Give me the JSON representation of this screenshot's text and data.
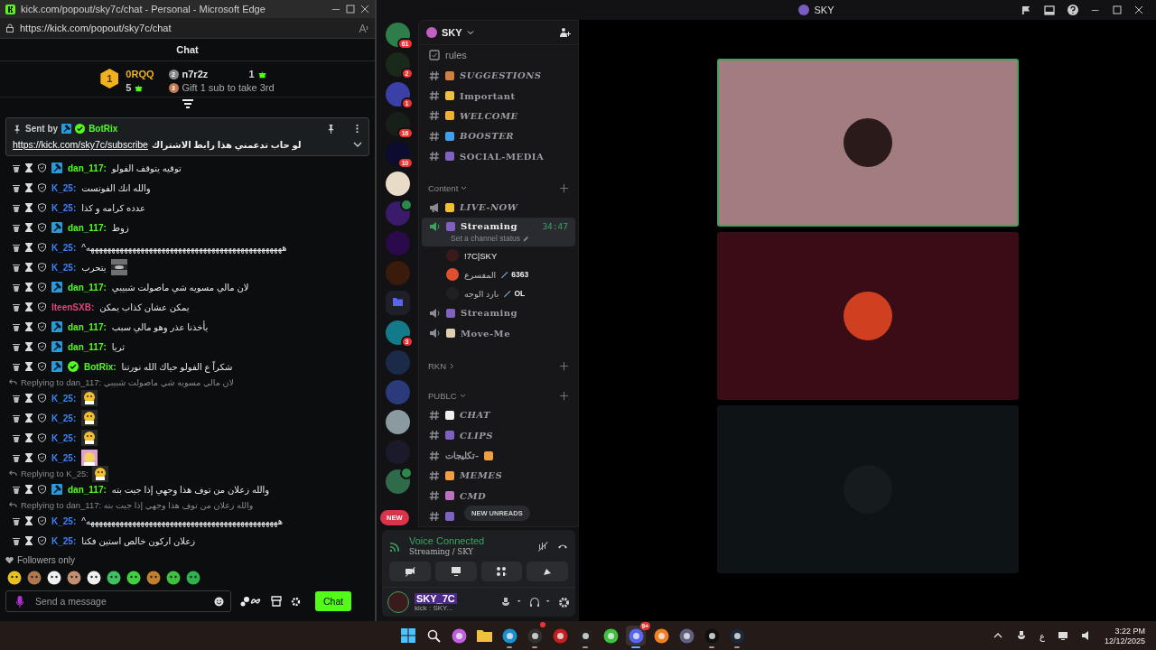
{
  "edge": {
    "title": "kick.com/popout/sky7c/chat - Personal - Microsoft Edge",
    "url": "https://kick.com/popout/sky7c/chat"
  },
  "kick": {
    "header": "Chat",
    "leaders": [
      {
        "rank": "1",
        "name": "0RQQ",
        "count": "5"
      },
      {
        "rank": "2",
        "name": "n7r2z",
        "count": "1"
      }
    ],
    "gift": {
      "rank": "3",
      "text": "Gift 1 sub to take 3rd"
    },
    "pinned": {
      "label": "Sent by",
      "user": "BotRix",
      "link": "https://kick.com/sky7c/subscribe",
      "text": "لو حاب تدعمني هذا رابط الاشتراك"
    },
    "messages": [
      {
        "user": "dan_117:",
        "color": "#53fc18",
        "mod": true,
        "verified": false,
        "text": "توقيه يتوقف الفولو"
      },
      {
        "user": "K_25:",
        "color": "#3b82f6",
        "mod": false,
        "verified": false,
        "text": "والله انك الفوتست"
      },
      {
        "user": "K_25:",
        "color": "#3b82f6",
        "mod": false,
        "verified": false,
        "text": "عدده كرامه و كذا"
      },
      {
        "user": "dan_117:",
        "color": "#53fc18",
        "mod": true,
        "verified": false,
        "text": "زوط"
      },
      {
        "user": "K_25:",
        "color": "#3b82f6",
        "mod": false,
        "verified": false,
        "text": "هههههههههههههههههههههههههههههههههههههههههههههههه^"
      },
      {
        "user": "K_25:",
        "color": "#3b82f6",
        "mod": false,
        "verified": false,
        "text": "يتحرب",
        "emote": {
          "kind": "photo"
        }
      },
      {
        "user": "dan_117:",
        "color": "#53fc18",
        "mod": true,
        "verified": false,
        "text": "لان مالي مسويه شي ماصولت شبيبي"
      },
      {
        "user": "IteenSXB:",
        "color": "#e0457b",
        "mod": false,
        "verified": false,
        "text": "يمكن عشان كذاب يمكن"
      },
      {
        "user": "dan_117:",
        "color": "#53fc18",
        "mod": true,
        "verified": false,
        "text": "يأخذنا عذر وهو مالي سبب"
      },
      {
        "user": "dan_117:",
        "color": "#53fc18",
        "mod": true,
        "verified": false,
        "text": "ثريا"
      },
      {
        "user": "BotRix:",
        "color": "#53fc18",
        "mod": true,
        "verified": true,
        "text": "شكراً ع الفولو حياك الله نورتنا"
      },
      {
        "reply": "Replying to dan_117: لان مالي مسويه شي ماصولت شبيبي",
        "user": "K_25:",
        "color": "#3b82f6",
        "mod": false,
        "verified": false,
        "emote": {
          "kind": "face"
        }
      },
      {
        "user": "K_25:",
        "color": "#3b82f6",
        "mod": false,
        "verified": false,
        "emote": {
          "kind": "face"
        }
      },
      {
        "user": "K_25:",
        "color": "#3b82f6",
        "mod": false,
        "verified": false,
        "emote": {
          "kind": "face"
        }
      },
      {
        "user": "K_25:",
        "color": "#3b82f6",
        "mod": false,
        "verified": false,
        "emote": {
          "kind": "pink"
        }
      },
      {
        "reply": "Replying to K_25:",
        "reply_emote": {
          "kind": "face"
        },
        "user": "dan_117:",
        "color": "#53fc18",
        "mod": true,
        "verified": false,
        "text": "والله زعلان من توف هذا وجهي إذا جيت بته"
      },
      {
        "reply": "Replying to dan_117: والله زعلان من توف هذا وجهي إذا جيت بته",
        "user": "K_25:",
        "color": "#3b82f6",
        "mod": false,
        "verified": false,
        "text": "ههههههههههههههههههههههههههههههههههههههههههههههه^"
      },
      {
        "user": "K_25:",
        "color": "#3b82f6",
        "mod": false,
        "verified": false,
        "text": "زعلان اركون خالص استين فكنا"
      }
    ],
    "mode": "Followers only",
    "emotes": [
      {
        "color": "#e8c020"
      },
      {
        "color": "#b07850"
      },
      {
        "color": "#f0f0f0"
      },
      {
        "color": "#c09070"
      },
      {
        "color": "#f0f0f0"
      },
      {
        "color": "#40c060"
      },
      {
        "color": "#40d040"
      },
      {
        "color": "#c08030"
      },
      {
        "color": "#40c040"
      },
      {
        "color": "#30b050"
      }
    ],
    "input": {
      "placeholder": "Send a message"
    },
    "send": "Chat"
  },
  "discord": {
    "title": "SKY",
    "servers": [
      {
        "kind": "server",
        "color": "#2f7d4a",
        "badge": "61",
        "speaker": false
      },
      {
        "kind": "server",
        "color": "#1a2a1a",
        "badge": "2",
        "speaker": false
      },
      {
        "kind": "server",
        "color": "#3b3fa8",
        "badge": "1",
        "speaker": false
      },
      {
        "kind": "server",
        "color": "#162018",
        "badge": "16",
        "speaker": false
      },
      {
        "kind": "server",
        "color": "#0c0c30",
        "badge": "10",
        "speaker": false
      },
      {
        "kind": "server",
        "color": "#e8dcc8",
        "speaker": false
      },
      {
        "kind": "server",
        "color": "#3a1a6a",
        "speaker": true
      },
      {
        "kind": "server",
        "color": "#2a0a4a",
        "speaker": false
      },
      {
        "kind": "server",
        "color": "#3a1a0a",
        "speaker": false
      },
      {
        "kind": "folder",
        "color": "#5865f2"
      },
      {
        "kind": "server",
        "color": "#137a8a",
        "badge": "3",
        "speaker": false
      },
      {
        "kind": "server",
        "color": "#1c2a4a",
        "speaker": false
      },
      {
        "kind": "server",
        "color": "#2a3a7a",
        "speaker": false
      },
      {
        "kind": "server",
        "color": "#8a9aa0",
        "speaker": false
      },
      {
        "kind": "server",
        "color": "#1a1a2a",
        "speaker": false
      },
      {
        "kind": "server",
        "color": "#2f6a4a",
        "speaker": true
      }
    ],
    "new": "NEW",
    "server_name": "SKY",
    "channels": [
      {
        "kind": "rules",
        "name": "rules"
      },
      {
        "kind": "text",
        "name": "SUGGESTIONS",
        "color": "#d08040",
        "italic": true
      },
      {
        "kind": "text",
        "name": "Important",
        "color": "#f0c040",
        "italic": false
      },
      {
        "kind": "text",
        "name": "WELCOME",
        "color": "#f0b030",
        "italic": true
      },
      {
        "kind": "text",
        "name": "BOOSTER",
        "color": "#40a0f0",
        "italic": true
      },
      {
        "kind": "text",
        "name": "SOCIAL-MEDIA",
        "color": "#8060c0",
        "italic": false
      },
      {
        "kind": "category",
        "name": "Content",
        "expanded": true
      },
      {
        "kind": "announce",
        "name": "LIVE-NOW",
        "color": "#f0c030",
        "italic": true
      },
      {
        "kind": "voice",
        "name": "Streaming",
        "color": "#8060c0",
        "italic": false,
        "selected": true,
        "time": "34:47",
        "status": "Set a channel status",
        "children": [
          {
            "name": "!7C|SKY",
            "color": "#3a1a1a"
          },
          {
            "name": "المفسرع",
            "color": "#e05030",
            "tag": "6363"
          },
          {
            "name": "بارد الوجه",
            "color": "#202020",
            "tag": "OL"
          }
        ]
      },
      {
        "kind": "voice",
        "name": "Streaming",
        "color": "#8060c0",
        "italic": false,
        "selected": false
      },
      {
        "kind": "voice",
        "name": "Move-Me",
        "color": "#e0d0b0",
        "italic": false,
        "selected": false
      },
      {
        "kind": "category",
        "name": "RKN",
        "expanded": false
      },
      {
        "kind": "category",
        "name": "PUBLC",
        "expanded": true
      },
      {
        "kind": "text",
        "name": "CHAT",
        "color": "#f0f0f0",
        "italic": true
      },
      {
        "kind": "text",
        "name": "CLIPS",
        "color": "#8060c0",
        "italic": true
      },
      {
        "kind": "text",
        "name": "-تكليجات",
        "color": "#f0a040",
        "italic": false,
        "trailing": true
      },
      {
        "kind": "text",
        "name": "MEMES",
        "color": "#f0a040",
        "italic": true
      },
      {
        "kind": "text",
        "name": "CMD",
        "color": "#c070c0",
        "italic": true
      },
      {
        "kind": "text",
        "color": "#8060c0"
      }
    ],
    "unreads": "NEW UNREADS",
    "voice": {
      "status": "Voice Connected",
      "channel": "Streaming / SKY"
    },
    "user": {
      "name": "SKY_7C",
      "status": "kick : SKY..."
    },
    "tiles": [
      {
        "color": "#a37c80",
        "speaking": true
      },
      {
        "color": "#3a0d16",
        "speaking": false
      },
      {
        "color": "#0e1315",
        "speaking": false
      }
    ]
  },
  "taskbar": {
    "apps": [
      {
        "kind": "start",
        "running": false
      },
      {
        "kind": "search",
        "running": false
      },
      {
        "kind": "app",
        "color": "#c060e0",
        "running": false
      },
      {
        "kind": "folder",
        "color": "#f0c040",
        "running": false
      },
      {
        "kind": "app",
        "color": "#1a90d0",
        "running": true
      },
      {
        "kind": "app",
        "color": "#303030",
        "running": true,
        "dot": true
      },
      {
        "kind": "app",
        "color": "#c02020",
        "running": false
      },
      {
        "kind": "app",
        "color": "#202020",
        "running": true
      },
      {
        "kind": "app",
        "color": "#40c040",
        "running": false
      },
      {
        "kind": "app",
        "color": "#5865f2",
        "running": true,
        "selected": true,
        "badge": "9+"
      },
      {
        "kind": "app",
        "color": "#f08020",
        "running": false
      },
      {
        "kind": "app",
        "color": "#606080",
        "running": false
      },
      {
        "kind": "app",
        "color": "#101010",
        "running": true
      },
      {
        "kind": "app",
        "color": "#1b2838",
        "running": true
      }
    ],
    "lang": "ع",
    "time": "3:22 PM",
    "date": "12/12/2025"
  }
}
